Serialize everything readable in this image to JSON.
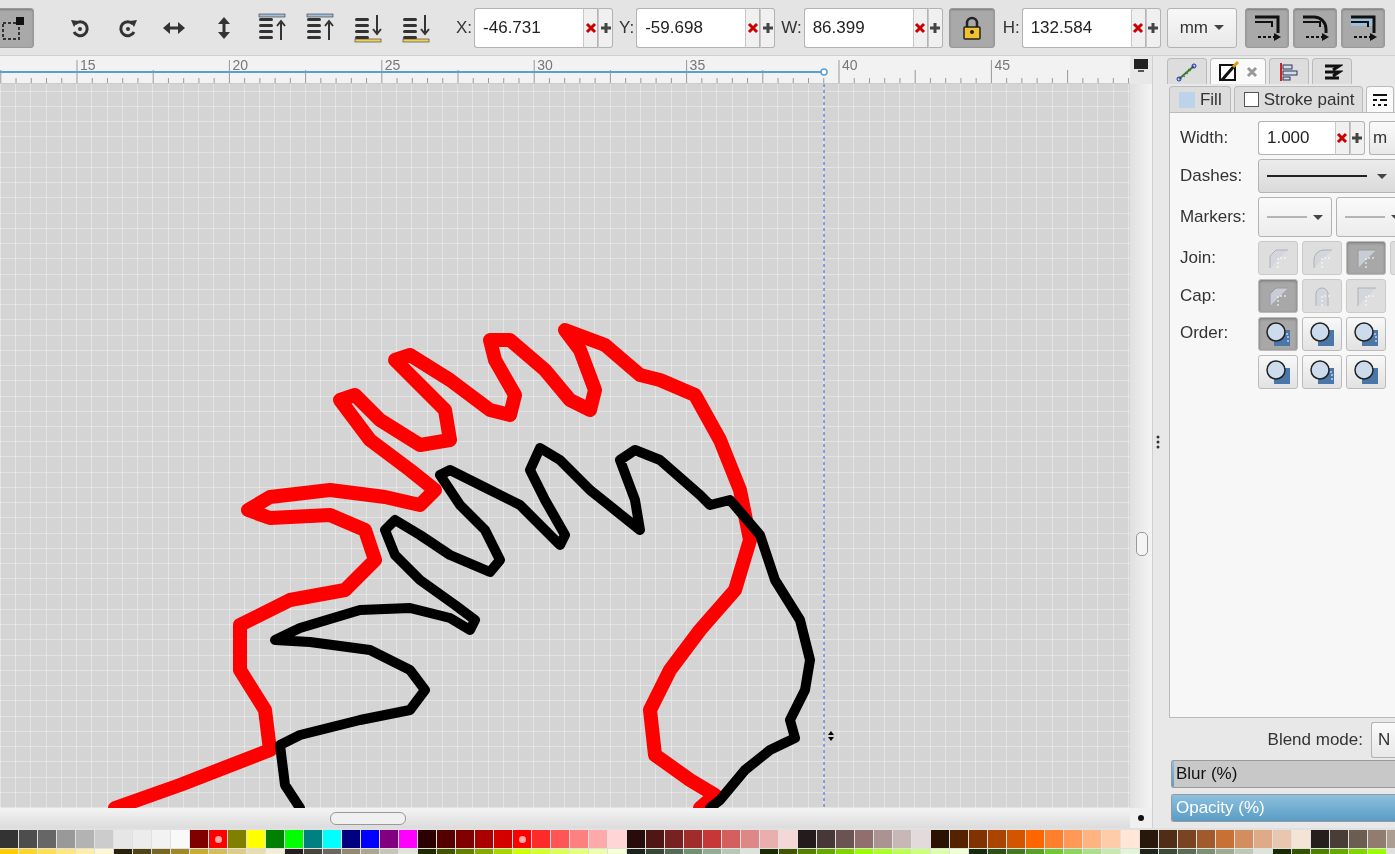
{
  "toolbar": {
    "select_toggle": {
      "on": true
    },
    "fields": [
      {
        "kind": "field",
        "label": "X:",
        "value": "-46.731"
      },
      {
        "kind": "field",
        "label": "Y:",
        "value": "-59.698"
      },
      {
        "kind": "field",
        "label": "W:",
        "value": "86.399"
      },
      {
        "kind": "lock",
        "on": true
      },
      {
        "kind": "field",
        "label": "H:",
        "value": "132.584"
      }
    ],
    "unit": "mm",
    "affect_toggles": [
      {
        "on": true
      },
      {
        "on": true
      },
      {
        "on": true
      }
    ]
  },
  "ruler": {
    "labels": [
      "15",
      "20",
      "25",
      "30",
      "35",
      "40",
      "45"
    ]
  },
  "dock_tabs": [
    {
      "selected": false,
      "closable": false
    },
    {
      "selected": true,
      "closable": true
    },
    {
      "selected": false,
      "closable": false
    },
    {
      "selected": false,
      "closable": false
    }
  ],
  "sub_tabs": [
    {
      "label": "Fill",
      "selected": false
    },
    {
      "label": "Stroke paint",
      "selected": false
    },
    {
      "selected": true
    }
  ],
  "stroke_style": {
    "width_label": "Width:",
    "width_value": "1.000",
    "width_unit": "m",
    "dashes_label": "Dashes:",
    "markers_label": "Markers:",
    "join_label": "Join:",
    "join_buttons": [
      {
        "selected": false
      },
      {
        "selected": false
      },
      {
        "selected": true
      },
      {
        "selected": false
      }
    ],
    "cap_label": "Cap:",
    "cap_buttons": [
      {
        "selected": true
      },
      {
        "selected": false
      },
      {
        "selected": false
      }
    ],
    "order_label": "Order:",
    "order_buttons": [
      {
        "selected": true
      },
      {
        "selected": false
      },
      {
        "selected": false
      },
      {
        "selected": false
      },
      {
        "selected": false
      },
      {
        "selected": false
      }
    ]
  },
  "blend_mode": {
    "label": "Blend mode:",
    "value": "N"
  },
  "blur": {
    "label": "Blur (%)",
    "level": 0.0
  },
  "opacity": {
    "label": "Opacity (%)",
    "level": 1.0
  },
  "palette": {
    "rows": [
      [
        {
          "color": "#333333"
        },
        {
          "color": "#4d4d4d"
        },
        {
          "color": "#666666"
        },
        {
          "color": "#999999"
        },
        {
          "color": "#b3b3b3"
        },
        {
          "color": "#cccccc"
        },
        {
          "color": "#e6e6e6"
        },
        {
          "color": "#ececec"
        },
        {
          "color": "#f2f2f2"
        },
        {
          "color": "#f9f9f9"
        },
        {
          "color": "#800000"
        },
        {
          "color": "#ff0000",
          "selected": true
        },
        {
          "color": "#808000"
        },
        {
          "color": "#ffff00"
        },
        {
          "color": "#008000"
        },
        {
          "color": "#00ff00"
        },
        {
          "color": "#008080"
        },
        {
          "color": "#00ffff"
        },
        {
          "color": "#000080"
        },
        {
          "color": "#0000ff"
        },
        {
          "color": "#800080"
        },
        {
          "color": "#ff00ff"
        },
        {
          "color": "#2b0000"
        },
        {
          "color": "#550000"
        },
        {
          "color": "#800000"
        },
        {
          "color": "#aa0000"
        },
        {
          "color": "#d40000"
        },
        {
          "color": "#ff0000",
          "selected": true
        },
        {
          "color": "#ff2a2a"
        },
        {
          "color": "#ff5555"
        },
        {
          "color": "#ff8080"
        },
        {
          "color": "#ffaaaa"
        },
        {
          "color": "#ffd5d5"
        },
        {
          "color": "#280b0b"
        },
        {
          "color": "#501616"
        },
        {
          "color": "#782121"
        },
        {
          "color": "#a02c2c"
        },
        {
          "color": "#c83737"
        },
        {
          "color": "#d35f5f"
        },
        {
          "color": "#de8787"
        },
        {
          "color": "#e9afaf"
        },
        {
          "color": "#f4d7d7"
        },
        {
          "color": "#241c1c"
        },
        {
          "color": "#483737"
        },
        {
          "color": "#6c5353"
        },
        {
          "color": "#916f6f"
        },
        {
          "color": "#ac9393"
        },
        {
          "color": "#c8b7b7"
        },
        {
          "color": "#e3dbdb"
        },
        {
          "color": "#2b1100"
        },
        {
          "color": "#552200"
        },
        {
          "color": "#803300"
        },
        {
          "color": "#aa4400"
        },
        {
          "color": "#d45500"
        },
        {
          "color": "#ff6600"
        },
        {
          "color": "#ff7f2a"
        },
        {
          "color": "#ff9955"
        },
        {
          "color": "#ffb380"
        },
        {
          "color": "#ffccaa"
        },
        {
          "color": "#ffe6d5"
        },
        {
          "color": "#28170b"
        },
        {
          "color": "#502d16"
        },
        {
          "color": "#784421"
        },
        {
          "color": "#a05a2c"
        },
        {
          "color": "#c87137"
        },
        {
          "color": "#d38d5f"
        },
        {
          "color": "#deaa87"
        },
        {
          "color": "#e9c6af"
        },
        {
          "color": "#f4e3d7"
        },
        {
          "color": "#241f1c"
        },
        {
          "color": "#483e37"
        },
        {
          "color": "#6c5d53"
        },
        {
          "color": "#917c6f"
        },
        {
          "color": "#ac9d93"
        }
      ],
      [
        {
          "color": "#ffcc00"
        },
        {
          "color": "#ffd42a"
        },
        {
          "color": "#ffdd55"
        },
        {
          "color": "#ffe680"
        },
        {
          "color": "#ffeeaa"
        },
        {
          "color": "#fff6d5"
        },
        {
          "color": "#28220b"
        },
        {
          "color": "#504416"
        },
        {
          "color": "#786721"
        },
        {
          "color": "#a0892c"
        },
        {
          "color": "#c8ab37"
        },
        {
          "color": "#d4bc5f"
        },
        {
          "color": "#decd87"
        },
        {
          "color": "#e9ddaf"
        },
        {
          "color": "#f4eed7"
        },
        {
          "color": "#241f1c"
        },
        {
          "color": "#48453e"
        },
        {
          "color": "#6c675d"
        },
        {
          "color": "#918a6f"
        },
        {
          "color": "#aca793"
        },
        {
          "color": "#c8c4b7"
        },
        {
          "color": "#e3e2db"
        },
        {
          "color": "#222b00"
        },
        {
          "color": "#445500"
        },
        {
          "color": "#668000"
        },
        {
          "color": "#88aa00"
        },
        {
          "color": "#aad400"
        },
        {
          "color": "#ccff00"
        },
        {
          "color": "#d4ff2a"
        },
        {
          "color": "#ddff55"
        },
        {
          "color": "#e5ff80"
        },
        {
          "color": "#eeffaa"
        },
        {
          "color": "#f6ffd5"
        },
        {
          "color": "#1c241c"
        },
        {
          "color": "#374837"
        },
        {
          "color": "#536c53"
        },
        {
          "color": "#6f916f"
        },
        {
          "color": "#93ac93"
        },
        {
          "color": "#b7c8b7"
        },
        {
          "color": "#dbe3db"
        },
        {
          "color": "#1c2b00"
        },
        {
          "color": "#445500"
        },
        {
          "color": "#558000"
        },
        {
          "color": "#66aa00"
        },
        {
          "color": "#7fd400"
        },
        {
          "color": "#99ff00"
        },
        {
          "color": "#aaff2a"
        },
        {
          "color": "#bbff55"
        },
        {
          "color": "#ccff80"
        },
        {
          "color": "#ddffaa"
        },
        {
          "color": "#eeffd5"
        },
        {
          "color": "#162d0b"
        },
        {
          "color": "#2d5016"
        },
        {
          "color": "#447821"
        },
        {
          "color": "#5aa02c"
        },
        {
          "color": "#71c837"
        },
        {
          "color": "#8dd35f"
        },
        {
          "color": "#aade87"
        },
        {
          "color": "#c6e9af"
        },
        {
          "color": "#e3f4d7"
        },
        {
          "color": "#1f241c"
        },
        {
          "color": "#3e4837"
        },
        {
          "color": "#5d6c53"
        },
        {
          "color": "#7c916f"
        },
        {
          "color": "#9dac93"
        },
        {
          "color": "#bec8b7"
        },
        {
          "color": "#dee3db"
        },
        {
          "color": "#1a2b00"
        },
        {
          "color": "#335500"
        },
        {
          "color": "#4d8000"
        },
        {
          "color": "#66aa00"
        },
        {
          "color": "#80d400"
        },
        {
          "color": "#99ff00"
        }
      ]
    ]
  }
}
